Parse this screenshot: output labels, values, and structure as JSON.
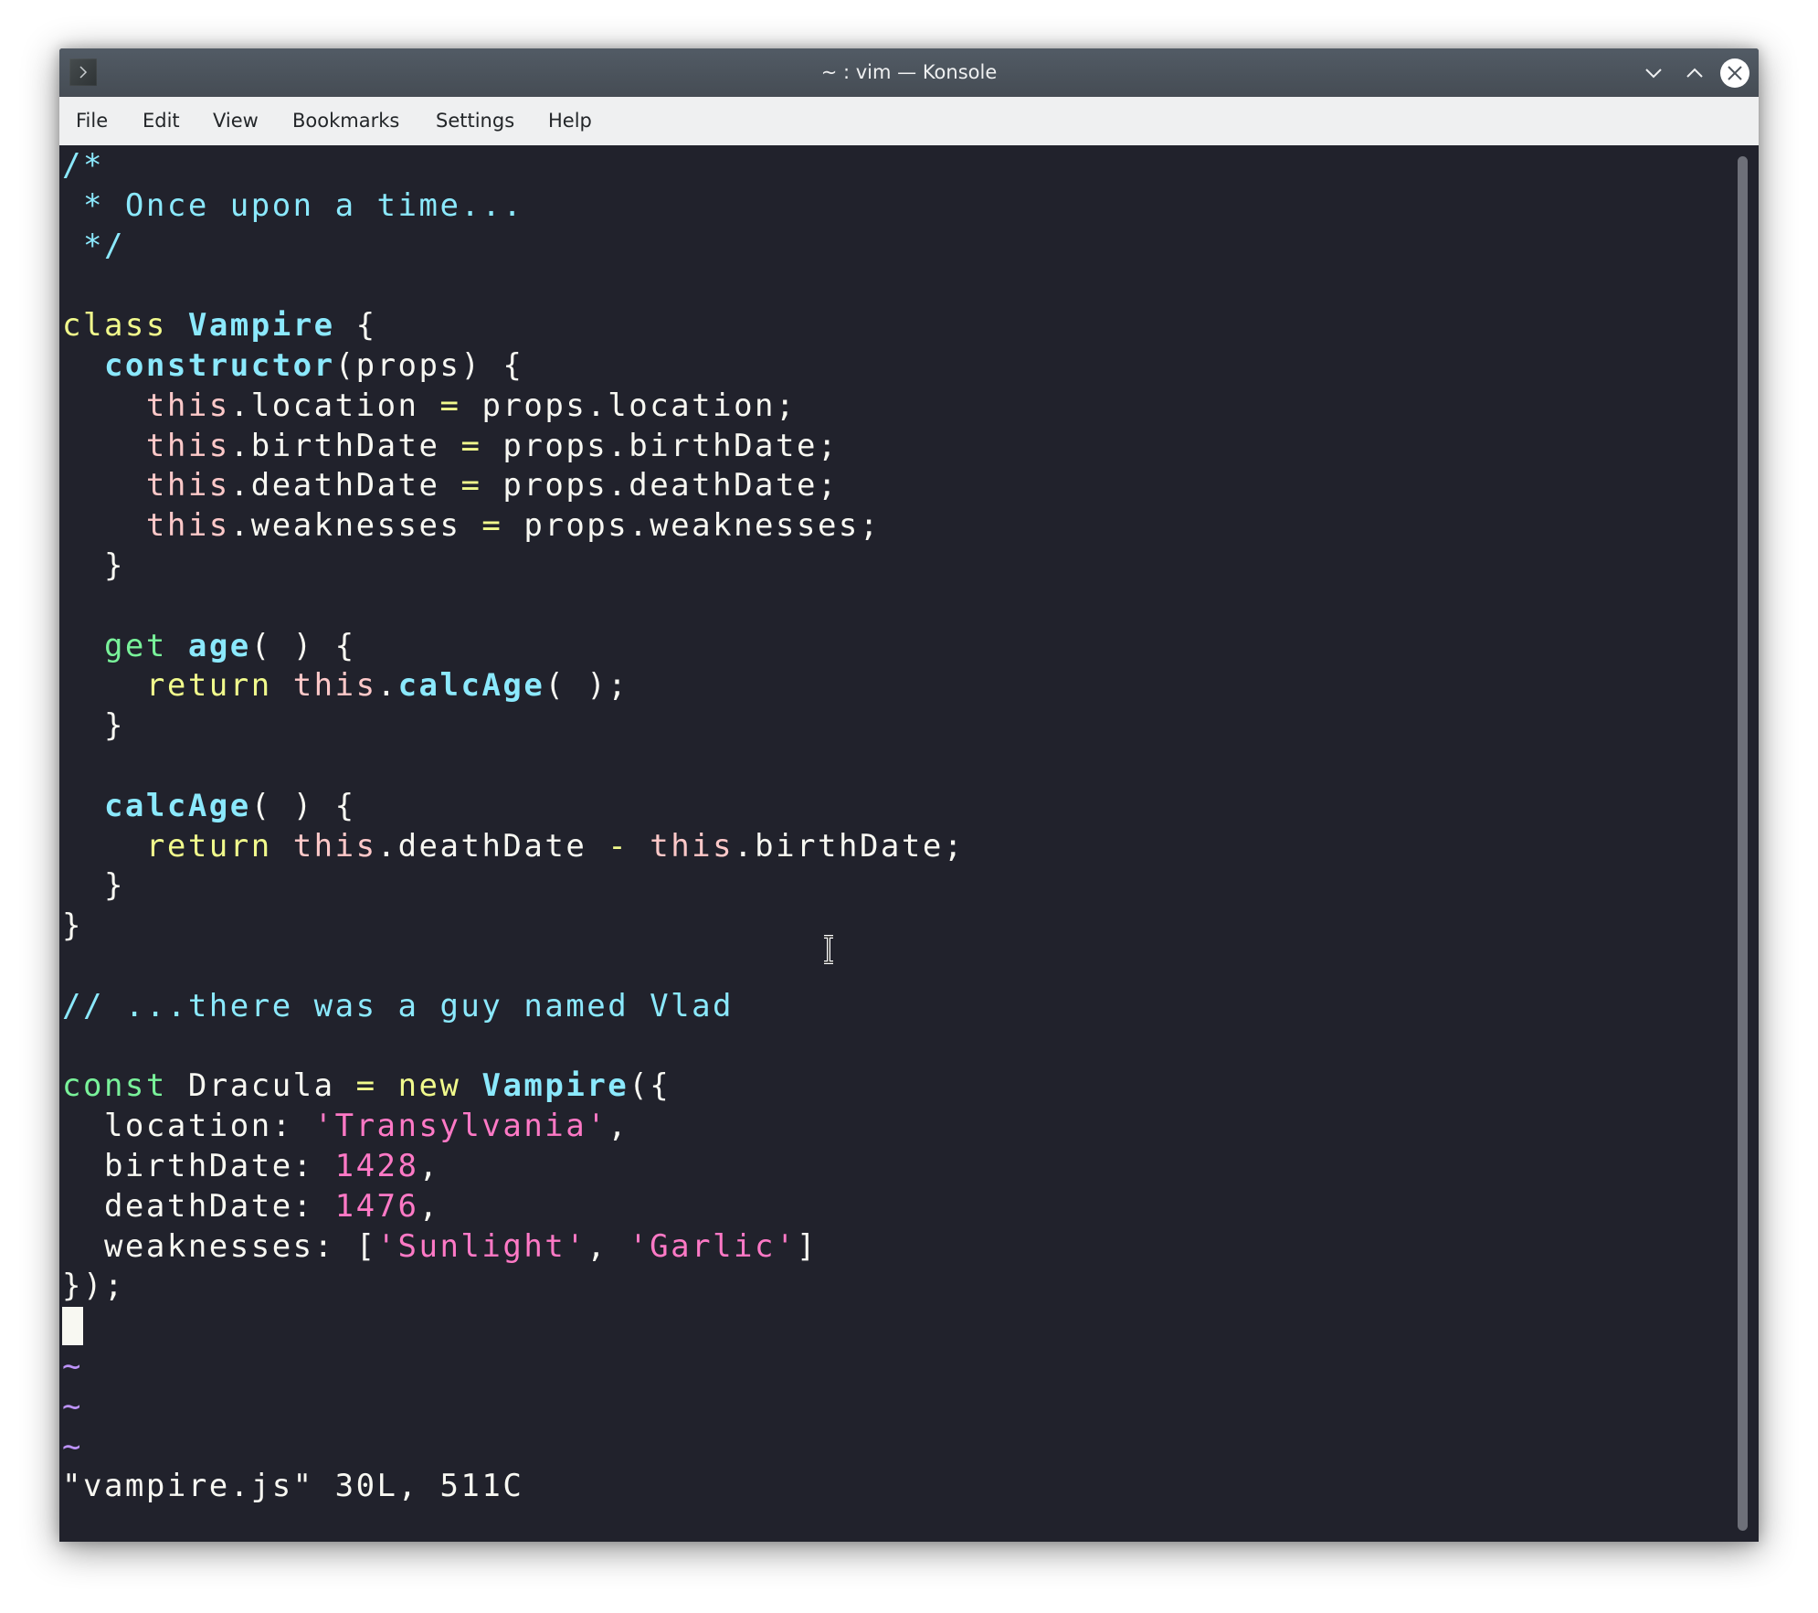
{
  "window": {
    "title": "~ : vim — Konsole",
    "icons": {
      "app": "terminal-prompt-icon",
      "minimize": "chevron-down-icon",
      "maximize": "chevron-up-icon",
      "close": "close-icon"
    }
  },
  "menubar": {
    "items": [
      "File",
      "Edit",
      "View",
      "Bookmarks",
      "Settings",
      "Help"
    ]
  },
  "colors": {
    "background": "#21222c",
    "comment": "#8be9fd",
    "keyword": "#f1fa8c",
    "storage": "#79f29a",
    "function": "#8be9fd",
    "this": "#ffc9c9",
    "string": "#ff79c6",
    "number": "#ff79c6",
    "tilde": "#bd93f9"
  },
  "editor": {
    "lines": [
      {
        "t": "c",
        "s": "/*"
      },
      {
        "t": "c",
        "s": " * Once upon a time..."
      },
      {
        "t": "c",
        "s": " */"
      },
      {
        "t": "b",
        "s": ""
      },
      {
        "parts": [
          [
            "kw",
            "class"
          ],
          [
            "p",
            " "
          ],
          [
            "fn",
            "Vampire"
          ],
          [
            "p",
            " {"
          ]
        ]
      },
      {
        "parts": [
          [
            "p",
            "  "
          ],
          [
            "fn",
            "constructor"
          ],
          [
            "p",
            "(props) {"
          ]
        ]
      },
      {
        "parts": [
          [
            "p",
            "    "
          ],
          [
            "this",
            "this"
          ],
          [
            "p",
            ".location "
          ],
          [
            "op",
            "="
          ],
          [
            "p",
            " props.location;"
          ]
        ]
      },
      {
        "parts": [
          [
            "p",
            "    "
          ],
          [
            "this",
            "this"
          ],
          [
            "p",
            ".birthDate "
          ],
          [
            "op",
            "="
          ],
          [
            "p",
            " props.birthDate;"
          ]
        ]
      },
      {
        "parts": [
          [
            "p",
            "    "
          ],
          [
            "this",
            "this"
          ],
          [
            "p",
            ".deathDate "
          ],
          [
            "op",
            "="
          ],
          [
            "p",
            " props.deathDate;"
          ]
        ]
      },
      {
        "parts": [
          [
            "p",
            "    "
          ],
          [
            "this",
            "this"
          ],
          [
            "p",
            ".weaknesses "
          ],
          [
            "op",
            "="
          ],
          [
            "p",
            " props.weaknesses;"
          ]
        ]
      },
      {
        "parts": [
          [
            "p",
            "  }"
          ]
        ]
      },
      {
        "t": "b",
        "s": ""
      },
      {
        "parts": [
          [
            "p",
            "  "
          ],
          [
            "kw2",
            "get"
          ],
          [
            "p",
            " "
          ],
          [
            "fn",
            "age"
          ],
          [
            "p",
            "( ) {"
          ]
        ]
      },
      {
        "parts": [
          [
            "p",
            "    "
          ],
          [
            "kw",
            "return"
          ],
          [
            "p",
            " "
          ],
          [
            "this",
            "this"
          ],
          [
            "p",
            "."
          ],
          [
            "fn",
            "calcAge"
          ],
          [
            "p",
            "( );"
          ]
        ]
      },
      {
        "parts": [
          [
            "p",
            "  }"
          ]
        ]
      },
      {
        "t": "b",
        "s": ""
      },
      {
        "parts": [
          [
            "p",
            "  "
          ],
          [
            "fn",
            "calcAge"
          ],
          [
            "p",
            "( ) {"
          ]
        ]
      },
      {
        "parts": [
          [
            "p",
            "    "
          ],
          [
            "kw",
            "return"
          ],
          [
            "p",
            " "
          ],
          [
            "this",
            "this"
          ],
          [
            "p",
            ".deathDate "
          ],
          [
            "op",
            "-"
          ],
          [
            "p",
            " "
          ],
          [
            "this",
            "this"
          ],
          [
            "p",
            ".birthDate;"
          ]
        ]
      },
      {
        "parts": [
          [
            "p",
            "  }"
          ]
        ]
      },
      {
        "parts": [
          [
            "p",
            "}"
          ]
        ]
      },
      {
        "t": "b",
        "s": ""
      },
      {
        "t": "c",
        "s": "// ...there was a guy named Vlad"
      },
      {
        "t": "b",
        "s": ""
      },
      {
        "parts": [
          [
            "kw2",
            "const"
          ],
          [
            "p",
            " Dracula "
          ],
          [
            "op",
            "="
          ],
          [
            "p",
            " "
          ],
          [
            "kw",
            "new"
          ],
          [
            "p",
            " "
          ],
          [
            "fn",
            "Vampire"
          ],
          [
            "p",
            "({"
          ]
        ]
      },
      {
        "parts": [
          [
            "p",
            "  location: "
          ],
          [
            "str",
            "'Transylvania'"
          ],
          [
            "p",
            ","
          ]
        ]
      },
      {
        "parts": [
          [
            "p",
            "  birthDate: "
          ],
          [
            "num",
            "1428"
          ],
          [
            "p",
            ","
          ]
        ]
      },
      {
        "parts": [
          [
            "p",
            "  deathDate: "
          ],
          [
            "num",
            "1476"
          ],
          [
            "p",
            ","
          ]
        ]
      },
      {
        "parts": [
          [
            "p",
            "  weaknesses: ["
          ],
          [
            "str",
            "'Sunlight'"
          ],
          [
            "p",
            ", "
          ],
          [
            "str",
            "'Garlic'"
          ],
          [
            "p",
            "]"
          ]
        ]
      },
      {
        "parts": [
          [
            "p",
            "});"
          ]
        ]
      },
      {
        "t": "cursor",
        "s": ""
      },
      {
        "t": "tilde",
        "s": "~"
      },
      {
        "t": "tilde",
        "s": "~"
      },
      {
        "t": "tilde",
        "s": "~"
      },
      {
        "t": "status",
        "s": "\"vampire.js\" 30L, 511C"
      }
    ],
    "status_message": "\"vampire.js\" 30L, 511C",
    "file_name": "vampire.js",
    "line_count": "30L",
    "char_count": "511C"
  }
}
